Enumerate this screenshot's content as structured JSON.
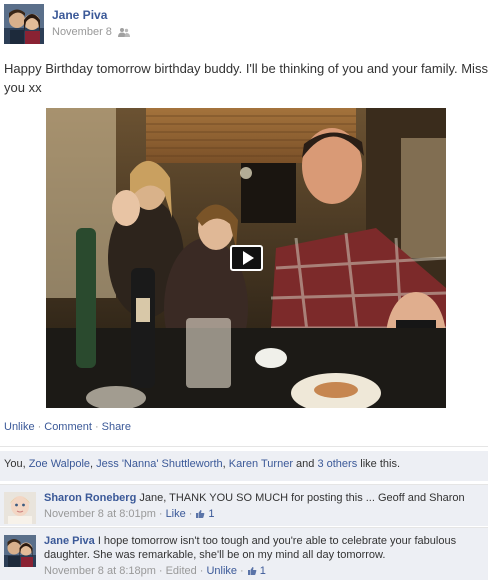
{
  "post": {
    "author": "Jane Piva",
    "date": "November 8",
    "privacy_icon": "friends-icon",
    "text": "Happy Birthday tomorrow birthday buddy. I'll be thinking of you and your family. Miss you xx"
  },
  "video": {
    "play_icon": "play-icon"
  },
  "actions": {
    "unlike": "Unlike",
    "comment": "Comment",
    "share": "Share",
    "separator": "·"
  },
  "likes": {
    "prefix": "You, ",
    "person1": "Zoe Walpole",
    "comma1": ", ",
    "person2": "Jess 'Nanna' Shuttleworth",
    "comma2": ", ",
    "person3": "Karen Turner",
    "and": " and ",
    "others": "3 others",
    "suffix": " like this."
  },
  "comments": [
    {
      "name": "Sharon Roneberg",
      "text": " Jane, THANK YOU SO MUCH for posting this ... Geoff and Sharon",
      "time": "November 8 at 8:01pm",
      "sep": "·",
      "like_label": "Like",
      "like_count": "1"
    },
    {
      "name": "Jane Piva",
      "text": " I hope tomorrow isn't too tough and you're able to celebrate your fabulous daughter. She was remarkable, she'll be on my mind all day tomorrow.",
      "time": "November 8 at 8:18pm",
      "sep": "·",
      "edited": "Edited",
      "like_label": "Unlike",
      "like_count": "1"
    }
  ]
}
